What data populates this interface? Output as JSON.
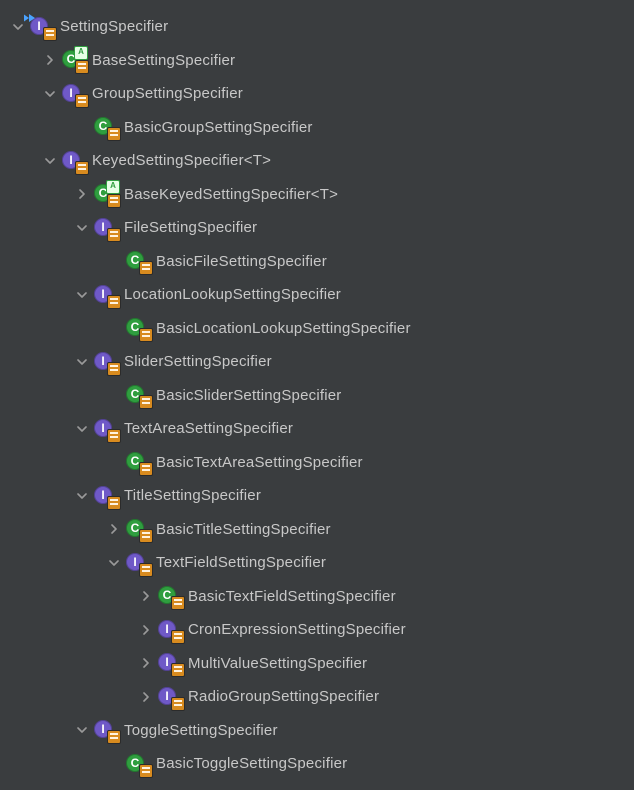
{
  "tree": [
    {
      "depth": 0,
      "expand": "open",
      "icon": "interface",
      "runnable": true,
      "abstract": false,
      "label": "SettingSpecifier"
    },
    {
      "depth": 1,
      "expand": "closed",
      "icon": "class",
      "runnable": false,
      "abstract": true,
      "label": "BaseSettingSpecifier"
    },
    {
      "depth": 1,
      "expand": "open",
      "icon": "interface",
      "runnable": false,
      "abstract": false,
      "label": "GroupSettingSpecifier"
    },
    {
      "depth": 2,
      "expand": "none",
      "icon": "class",
      "runnable": false,
      "abstract": false,
      "label": "BasicGroupSettingSpecifier"
    },
    {
      "depth": 1,
      "expand": "open",
      "icon": "interface",
      "runnable": false,
      "abstract": false,
      "label": "KeyedSettingSpecifier<T>"
    },
    {
      "depth": 2,
      "expand": "closed",
      "icon": "class",
      "runnable": false,
      "abstract": true,
      "label": "BaseKeyedSettingSpecifier<T>"
    },
    {
      "depth": 2,
      "expand": "open",
      "icon": "interface",
      "runnable": false,
      "abstract": false,
      "label": "FileSettingSpecifier"
    },
    {
      "depth": 3,
      "expand": "none",
      "icon": "class",
      "runnable": false,
      "abstract": false,
      "label": "BasicFileSettingSpecifier"
    },
    {
      "depth": 2,
      "expand": "open",
      "icon": "interface",
      "runnable": false,
      "abstract": false,
      "label": "LocationLookupSettingSpecifier"
    },
    {
      "depth": 3,
      "expand": "none",
      "icon": "class",
      "runnable": false,
      "abstract": false,
      "label": "BasicLocationLookupSettingSpecifier"
    },
    {
      "depth": 2,
      "expand": "open",
      "icon": "interface",
      "runnable": false,
      "abstract": false,
      "label": "SliderSettingSpecifier"
    },
    {
      "depth": 3,
      "expand": "none",
      "icon": "class",
      "runnable": false,
      "abstract": false,
      "label": "BasicSliderSettingSpecifier"
    },
    {
      "depth": 2,
      "expand": "open",
      "icon": "interface",
      "runnable": false,
      "abstract": false,
      "label": "TextAreaSettingSpecifier"
    },
    {
      "depth": 3,
      "expand": "none",
      "icon": "class",
      "runnable": false,
      "abstract": false,
      "label": "BasicTextAreaSettingSpecifier"
    },
    {
      "depth": 2,
      "expand": "open",
      "icon": "interface",
      "runnable": false,
      "abstract": false,
      "label": "TitleSettingSpecifier"
    },
    {
      "depth": 3,
      "expand": "closed",
      "icon": "class",
      "runnable": false,
      "abstract": false,
      "label": "BasicTitleSettingSpecifier"
    },
    {
      "depth": 3,
      "expand": "open",
      "icon": "interface",
      "runnable": false,
      "abstract": false,
      "label": "TextFieldSettingSpecifier"
    },
    {
      "depth": 4,
      "expand": "closed",
      "icon": "class",
      "runnable": false,
      "abstract": false,
      "label": "BasicTextFieldSettingSpecifier"
    },
    {
      "depth": 4,
      "expand": "closed",
      "icon": "interface",
      "runnable": false,
      "abstract": false,
      "label": "CronExpressionSettingSpecifier"
    },
    {
      "depth": 4,
      "expand": "closed",
      "icon": "interface",
      "runnable": false,
      "abstract": false,
      "label": "MultiValueSettingSpecifier"
    },
    {
      "depth": 4,
      "expand": "closed",
      "icon": "interface",
      "runnable": false,
      "abstract": false,
      "label": "RadioGroupSettingSpecifier"
    },
    {
      "depth": 2,
      "expand": "open",
      "icon": "interface",
      "runnable": false,
      "abstract": false,
      "label": "ToggleSettingSpecifier"
    },
    {
      "depth": 3,
      "expand": "none",
      "icon": "class",
      "runnable": false,
      "abstract": false,
      "label": "BasicToggleSettingSpecifier"
    }
  ]
}
